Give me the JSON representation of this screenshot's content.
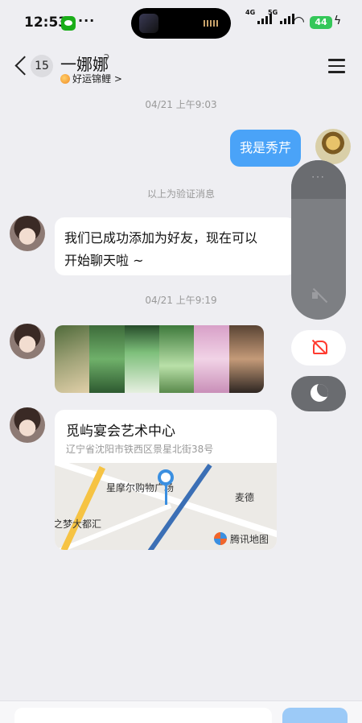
{
  "status_bar": {
    "time": "12:53",
    "more": "···",
    "net_4g": "4G",
    "net_5g": "5G",
    "battery": "44"
  },
  "header": {
    "unread_count": "15",
    "name": "一娜娜",
    "subtitle": "好运锦鲤 >"
  },
  "messages": [
    {
      "type": "timestamp",
      "text": "04/21 上午9:03"
    },
    {
      "type": "outgoing-text",
      "text": "我是秀芹"
    },
    {
      "type": "system",
      "text": "以上为验证消息"
    },
    {
      "type": "incoming-text",
      "line1": "我们已成功添加为好友，现在可以",
      "line2": "开始聊天啦 ~"
    },
    {
      "type": "timestamp",
      "text": "04/21 上午9:19"
    },
    {
      "type": "incoming-image",
      "description": "image"
    },
    {
      "type": "incoming-location",
      "title": "觅屿宴会艺术中心",
      "address": "辽宁省沈阳市铁西区景星北街38号",
      "map_labels": [
        "星摩尔购物广场",
        "麦德",
        "之梦大都汇"
      ],
      "map_provider": "腾讯地图"
    }
  ],
  "volume_overlay": {
    "dots": "···",
    "level": 0
  },
  "colors": {
    "outgoing_bubble": "#4aa3f8",
    "background": "#eeeef2",
    "map_pin": "#3b8fe0"
  }
}
